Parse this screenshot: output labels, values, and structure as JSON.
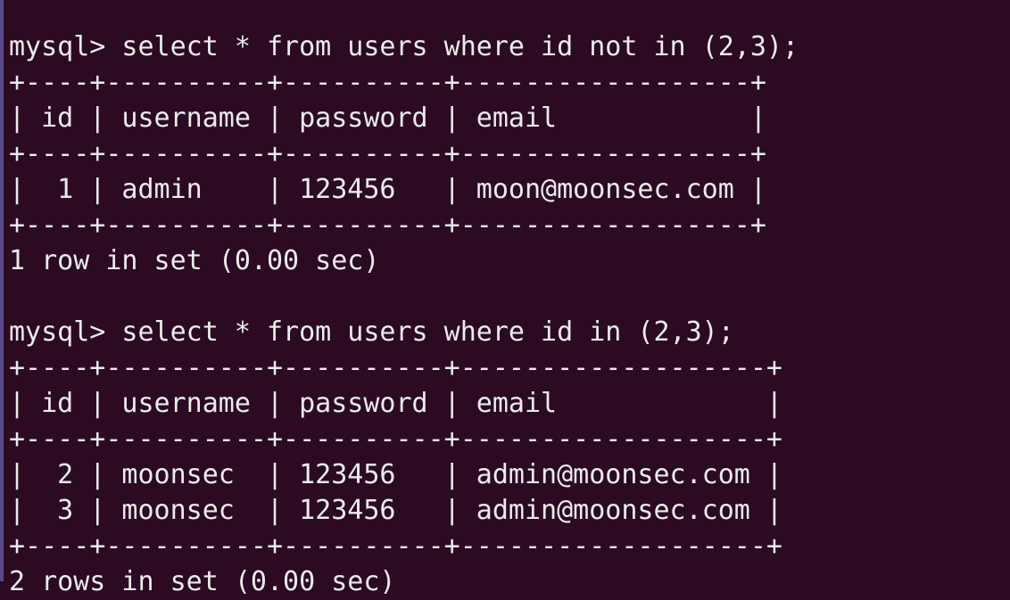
{
  "window": {
    "accent_left_edge": "#5a4a8c",
    "background": "#2c0a22",
    "foreground": "#ebebeb"
  },
  "terminal": {
    "lines": [
      "mysql> select * from users where id not in (2,3);",
      "+----+----------+----------+------------------+",
      "| id | username | password | email            |",
      "+----+----------+----------+------------------+",
      "|  1 | admin    | 123456   | moon@moonsec.com |",
      "+----+----------+----------+------------------+",
      "1 row in set (0.00 sec)",
      "",
      "mysql> select * from users where id in (2,3);",
      "+----+----------+----------+-------------------+",
      "| id | username | password | email             |",
      "+----+----------+----------+-------------------+",
      "|  2 | moonsec  | 123456   | admin@moonsec.com |",
      "|  3 | moonsec  | 123456   | admin@moonsec.com |",
      "+----+----------+----------+-------------------+",
      "2 rows in set (0.00 sec)"
    ]
  }
}
